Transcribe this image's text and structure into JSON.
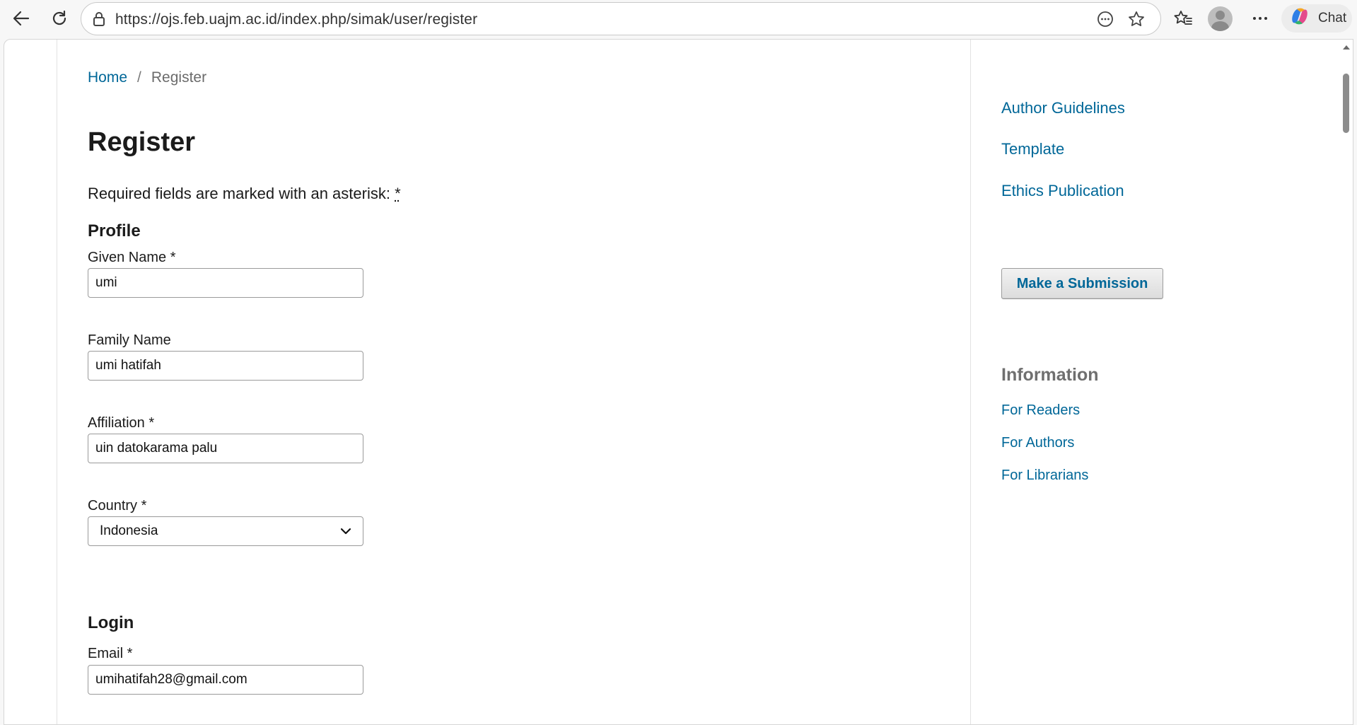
{
  "browser": {
    "url": "https://ojs.feb.uajm.ac.id/index.php/simak/user/register",
    "chat_label": "Chat"
  },
  "breadcrumb": {
    "home": "Home",
    "separator": "/",
    "current": "Register"
  },
  "page": {
    "title": "Register",
    "required_note": "Required fields are marked with an asterisk:",
    "asterisk": "*"
  },
  "profile": {
    "heading": "Profile",
    "given_name": {
      "label": "Given Name *",
      "value": "umi"
    },
    "family_name": {
      "label": "Family Name",
      "value": "umi hatifah"
    },
    "affiliation": {
      "label": "Affiliation *",
      "value": "uin datokarama palu"
    },
    "country": {
      "label": "Country *",
      "value": "Indonesia"
    }
  },
  "login": {
    "heading": "Login",
    "email": {
      "label": "Email *",
      "value": "umihatifah28@gmail.com"
    }
  },
  "sidebar": {
    "links": [
      "Author Guidelines",
      "Template",
      "Ethics Publication"
    ],
    "submit_label": "Make a Submission",
    "info_heading": "Information",
    "info_links": [
      "For Readers",
      "For Authors",
      "For Librarians"
    ]
  },
  "colors": {
    "link": "#006798",
    "text": "#1b1b1b",
    "sidebar_heading": "#6f6f6f"
  }
}
